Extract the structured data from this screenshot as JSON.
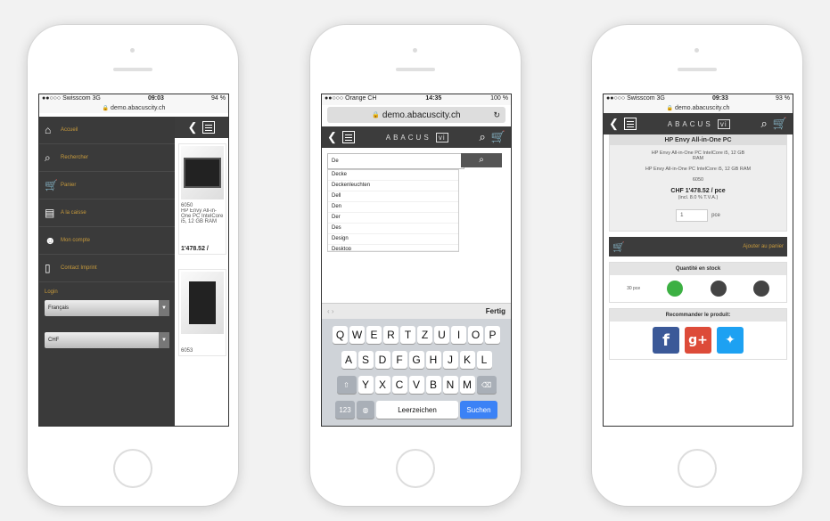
{
  "phone1": {
    "status": {
      "carrier": "●●○○○ Swisscom 3G",
      "time": "09:03",
      "battery": "94 %"
    },
    "url": "demo.abacuscity.ch",
    "menu": [
      {
        "label": "Accueil",
        "icon": "home-icon",
        "glyph": "⌂"
      },
      {
        "label": "Rechercher",
        "icon": "search-icon",
        "glyph": "⌕"
      },
      {
        "label": "Panier",
        "icon": "cart-icon",
        "glyph": "🛒"
      },
      {
        "label": "A la caisse",
        "icon": "cashier-icon",
        "glyph": "▤"
      },
      {
        "label": "Mon compte",
        "icon": "account-icon",
        "glyph": "☻"
      },
      {
        "label": "Contact Imprint",
        "icon": "document-icon",
        "glyph": "▯"
      }
    ],
    "language_label": "Login",
    "language_value": "Français",
    "currency_value": "CHF",
    "product": {
      "id": "6050",
      "title": "HP Envy All-in-One PC IntelCore i5, 12 GB RAM",
      "price": "1'478.52 /"
    },
    "product2_id": "6053"
  },
  "phone2": {
    "status": {
      "carrier": "●●○○○ Orange CH",
      "time": "14:35",
      "battery": "100 %"
    },
    "url": "demo.abacuscity.ch",
    "logo": "ABACUS",
    "logo_mark": "vi",
    "search_value": "De",
    "suggestions": [
      "Decke",
      "Deckenleuchten",
      "Dell",
      "Den",
      "Der",
      "Des",
      "Design",
      "Desktop"
    ],
    "done_label": "Fertig",
    "keys_row1": [
      "Q",
      "W",
      "E",
      "R",
      "T",
      "Z",
      "U",
      "I",
      "O",
      "P"
    ],
    "keys_row2": [
      "A",
      "S",
      "D",
      "F",
      "G",
      "H",
      "J",
      "K",
      "L"
    ],
    "keys_row3": [
      "Y",
      "X",
      "C",
      "V",
      "B",
      "N",
      "M"
    ],
    "key_num": "123",
    "key_space": "Leerzeichen",
    "key_go": "Suchen"
  },
  "phone3": {
    "status": {
      "carrier": "●●○○○ Swisscom 3G",
      "time": "09:33",
      "battery": "93 %"
    },
    "url": "demo.abacuscity.ch",
    "logo": "ABACUS",
    "logo_mark": "vi",
    "product_title": "HP Envy All-in-One PC",
    "product_sub": "HP Envy All-in-One PC IntelCore i5, 12 GB RAM",
    "product_desc": "HP Envy All-in-One PC IntelCore i5, 12 GB RAM",
    "product_id": "6050",
    "price": "CHF 1'478.52 / pce",
    "price_note": "(incl. 8.0 % T.V.A.)",
    "qty_value": "1",
    "qty_unit": "pce",
    "add_to_cart": "Ajouter au panier",
    "stock_header": "Quantité en stock",
    "stock_label": "30 pce",
    "recommend_header": "Recommander le produit:",
    "colors": {
      "green": "#3cb043",
      "dark": "#444444",
      "facebook": "#3b5998",
      "gplus": "#dd4b39",
      "twitter": "#1da1f2",
      "accent": "#c79a3c"
    }
  }
}
